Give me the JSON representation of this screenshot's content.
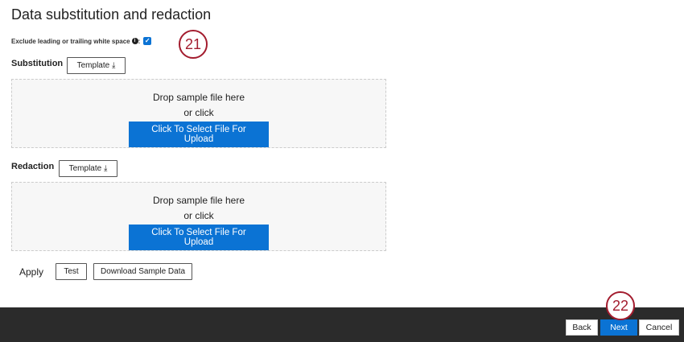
{
  "title": "Data substitution and redaction",
  "exclude_label": "Exclude leading or trailing white space",
  "exclude_checked": true,
  "substitution": {
    "label": "Substitution",
    "template": "Template",
    "drop": "Drop sample file here",
    "or": "or click",
    "upload": "Click To Select File For Upload"
  },
  "redaction": {
    "label": "Redaction",
    "template": "Template",
    "drop": "Drop sample file here",
    "or": "or click",
    "upload": "Click To Select File For Upload"
  },
  "apply": {
    "label": "Apply",
    "test": "Test",
    "download": "Download Sample Data"
  },
  "footer": {
    "back": "Back",
    "next": "Next",
    "cancel": "Cancel"
  },
  "annotations": [
    "21",
    "22"
  ]
}
